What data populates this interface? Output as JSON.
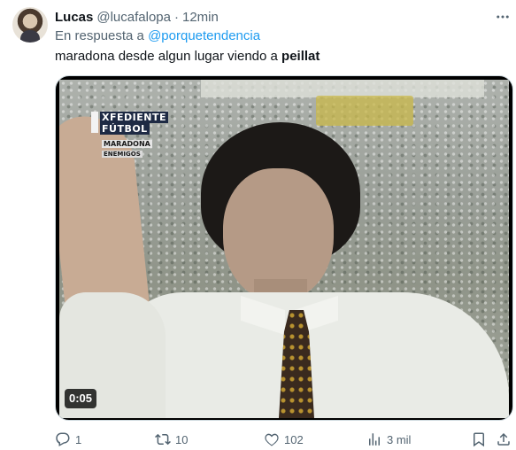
{
  "tweet": {
    "author_name": "Lucas",
    "author_handle": "@lucafalopa",
    "separator": "·",
    "time": "12min",
    "reply_prefix": "En respuesta a",
    "reply_to": "@porquetendencia",
    "text_start": "maradona desde algun lugar viendo a ",
    "text_bold": "peillat"
  },
  "video": {
    "duration": "0:05",
    "overlay_logo": {
      "line1": "XFEDIENTE",
      "line2": "FÚTBOL",
      "line3": "MARADONA",
      "line4": "ENEMIGOS"
    }
  },
  "actions": {
    "replies": "1",
    "retweets": "10",
    "likes": "102",
    "views": "3 mil"
  },
  "colors": {
    "text": "#0f1419",
    "secondary": "#536471",
    "link": "#1d9bf0"
  },
  "icons": [
    "more-icon",
    "reply-icon",
    "retweet-icon",
    "like-icon",
    "views-icon",
    "bookmark-icon",
    "share-icon"
  ]
}
